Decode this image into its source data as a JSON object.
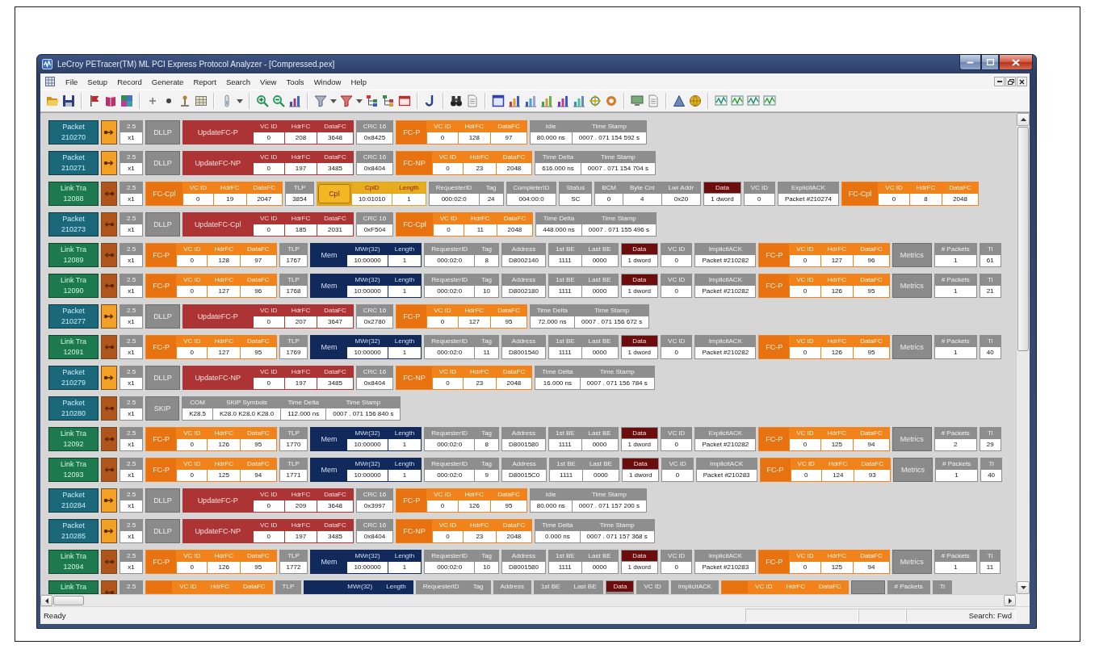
{
  "window": {
    "title": "LeCroy PETracer(TM) ML PCI Express Protocol Analyzer - [Compressed.pex]"
  },
  "menu": [
    "File",
    "Setup",
    "Record",
    "Generate",
    "Report",
    "Search",
    "View",
    "Tools",
    "Window",
    "Help"
  ],
  "rows": [
    {
      "kind": "packet",
      "label": "Packet",
      "number": "210270",
      "upstream": false,
      "cells": [
        {
          "kind": "field",
          "columns": [
            {
              "header": "2.5",
              "value": "x1"
            }
          ]
        },
        {
          "kind": "tag",
          "label": "DLLP"
        },
        {
          "kind": "update_fc",
          "label": "UpdateFC-P",
          "columns": [
            {
              "header": "VC ID",
              "value": "0"
            },
            {
              "header": "HdrFC",
              "value": "208"
            },
            {
              "header": "DataFC",
              "value": "3648"
            }
          ]
        },
        {
          "kind": "field",
          "columns": [
            {
              "header": "CRC 16",
              "value": "0x8425"
            }
          ]
        },
        {
          "kind": "fc",
          "label": "FC-P",
          "columns": [
            {
              "header": "VC ID",
              "value": "0"
            },
            {
              "header": "HdrFC",
              "value": "128"
            },
            {
              "header": "DataFC",
              "value": "97"
            }
          ]
        },
        {
          "kind": "field",
          "columns": [
            {
              "header": "Idle",
              "value": "80.000 ns"
            },
            {
              "header": "Time Stamp",
              "value": "0007 . 071 154 592 s"
            }
          ]
        }
      ]
    },
    {
      "kind": "packet",
      "label": "Packet",
      "number": "210271",
      "upstream": false,
      "cells": [
        {
          "kind": "field",
          "columns": [
            {
              "header": "2.5",
              "value": "x1"
            }
          ]
        },
        {
          "kind": "tag",
          "label": "DLLP"
        },
        {
          "kind": "update_fc",
          "label": "UpdateFC-NP",
          "columns": [
            {
              "header": "VC ID",
              "value": "0"
            },
            {
              "header": "HdrFC",
              "value": "197"
            },
            {
              "header": "DataFC",
              "value": "3485"
            }
          ]
        },
        {
          "kind": "field",
          "columns": [
            {
              "header": "CRC 16",
              "value": "0x8404"
            }
          ]
        },
        {
          "kind": "fc",
          "label": "FC-NP",
          "columns": [
            {
              "header": "VC ID",
              "value": "0"
            },
            {
              "header": "HdrFC",
              "value": "23"
            },
            {
              "header": "DataFC",
              "value": "2048"
            }
          ]
        },
        {
          "kind": "field",
          "columns": [
            {
              "header": "Time Delta",
              "value": "616.000 ns"
            },
            {
              "header": "Time Stamp",
              "value": "0007 . 071 154 704 s"
            }
          ]
        }
      ]
    },
    {
      "kind": "link",
      "label": "Link Tra",
      "number": "12088",
      "upstream": true,
      "cells": [
        {
          "kind": "field",
          "columns": [
            {
              "header": "2.5",
              "value": "x1"
            }
          ]
        },
        {
          "kind": "fc",
          "label": "FC-Cpl",
          "columns": [
            {
              "header": "VC ID",
              "value": "0"
            },
            {
              "header": "HdrFC",
              "value": "19"
            },
            {
              "header": "DataFC",
              "value": "2047"
            }
          ]
        },
        {
          "kind": "field",
          "columns": [
            {
              "header": "TLP",
              "value": "3854"
            }
          ]
        },
        {
          "kind": "cpl",
          "label": "Cpl",
          "columns": [
            {
              "header": "CplD",
              "value": "10:01010"
            },
            {
              "header": "Length",
              "value": "1"
            }
          ]
        },
        {
          "kind": "field",
          "columns": [
            {
              "header": "RequesterID",
              "value": "000:02:0"
            },
            {
              "header": "Tag",
              "value": "24"
            }
          ]
        },
        {
          "kind": "field",
          "columns": [
            {
              "header": "CompleterID",
              "value": "004:00:0"
            }
          ]
        },
        {
          "kind": "field",
          "columns": [
            {
              "header": "Status",
              "value": "SC"
            }
          ]
        },
        {
          "kind": "field",
          "columns": [
            {
              "header": "BCM",
              "value": "0"
            },
            {
              "header": "Byte Cnt",
              "value": "4"
            },
            {
              "header": "Lwr Addr",
              "value": "0x20"
            }
          ]
        },
        {
          "kind": "data",
          "columns": [
            {
              "header": "Data",
              "value": "1 dword"
            }
          ]
        },
        {
          "kind": "field",
          "columns": [
            {
              "header": "VC ID",
              "value": "0"
            }
          ]
        },
        {
          "kind": "field",
          "columns": [
            {
              "header": "ExplicitACK",
              "value": "Packet #210274"
            }
          ]
        },
        {
          "kind": "fc",
          "label": "FC-Cpl",
          "columns": [
            {
              "header": "VC ID",
              "value": "0"
            },
            {
              "header": "HdrFC",
              "value": "8"
            },
            {
              "header": "DataFC",
              "value": "2048"
            }
          ]
        }
      ]
    },
    {
      "kind": "packet",
      "label": "Packet",
      "number": "210273",
      "upstream": true,
      "cells": [
        {
          "kind": "field",
          "columns": [
            {
              "header": "2.5",
              "value": "x1"
            }
          ]
        },
        {
          "kind": "tag",
          "label": "DLLP"
        },
        {
          "kind": "update_fc",
          "label": "UpdateFC-Cpl",
          "columns": [
            {
              "header": "VC ID",
              "value": "0"
            },
            {
              "header": "HdrFC",
              "value": "185"
            },
            {
              "header": "DataFC",
              "value": "2031"
            }
          ]
        },
        {
          "kind": "field",
          "columns": [
            {
              "header": "CRC 16",
              "value": "0xF504"
            }
          ]
        },
        {
          "kind": "fc",
          "label": "FC-Cpl",
          "columns": [
            {
              "header": "VC ID",
              "value": "0"
            },
            {
              "header": "HdrFC",
              "value": "11"
            },
            {
              "header": "DataFC",
              "value": "2048"
            }
          ]
        },
        {
          "kind": "field",
          "columns": [
            {
              "header": "Time Delta",
              "value": "448.000 ns"
            },
            {
              "header": "Time Stamp",
              "value": "0007 . 071 155 496 s"
            }
          ]
        }
      ]
    },
    {
      "kind": "link",
      "label": "Link Tra",
      "number": "12089",
      "upstream": true,
      "cells": [
        {
          "kind": "field",
          "columns": [
            {
              "header": "2.5",
              "value": "x1"
            }
          ]
        },
        {
          "kind": "fc",
          "label": "FC-P",
          "columns": [
            {
              "header": "VC ID",
              "value": "0"
            },
            {
              "header": "HdrFC",
              "value": "128"
            },
            {
              "header": "DataFC",
              "value": "97"
            }
          ]
        },
        {
          "kind": "field",
          "columns": [
            {
              "header": "TLP",
              "value": "1767"
            }
          ]
        },
        {
          "kind": "mem",
          "label": "Mem",
          "columns": [
            {
              "header": "MWr(32)",
              "value": "10:00000"
            },
            {
              "header": "Length",
              "value": "1"
            }
          ]
        },
        {
          "kind": "field",
          "columns": [
            {
              "header": "RequesterID",
              "value": "000:02:0"
            },
            {
              "header": "Tag",
              "value": "8"
            }
          ]
        },
        {
          "kind": "field",
          "columns": [
            {
              "header": "Address",
              "value": "D8002140"
            }
          ]
        },
        {
          "kind": "field",
          "columns": [
            {
              "header": "1st BE",
              "value": "1111"
            },
            {
              "header": "Last BE",
              "value": "0000"
            }
          ]
        },
        {
          "kind": "data",
          "columns": [
            {
              "header": "Data",
              "value": "1 dword"
            }
          ]
        },
        {
          "kind": "field",
          "columns": [
            {
              "header": "VC ID",
              "value": "0"
            }
          ]
        },
        {
          "kind": "field",
          "columns": [
            {
              "header": "ImplicitACK",
              "value": "Packet #210282"
            }
          ]
        },
        {
          "kind": "fc",
          "label": "FC-P",
          "columns": [
            {
              "header": "VC ID",
              "value": "0"
            },
            {
              "header": "HdrFC",
              "value": "127"
            },
            {
              "header": "DataFC",
              "value": "96"
            }
          ]
        },
        {
          "kind": "tag",
          "label": "Metrics"
        },
        {
          "kind": "field",
          "columns": [
            {
              "header": "# Packets",
              "value": "1"
            }
          ]
        },
        {
          "kind": "field",
          "columns": [
            {
              "header": "Ti",
              "value": "61"
            }
          ]
        }
      ]
    },
    {
      "kind": "link",
      "label": "Link Tra",
      "number": "12090",
      "upstream": true,
      "cells": [
        {
          "kind": "field",
          "columns": [
            {
              "header": "2.5",
              "value": "x1"
            }
          ]
        },
        {
          "kind": "fc",
          "label": "FC-P",
          "columns": [
            {
              "header": "VC ID",
              "value": "0"
            },
            {
              "header": "HdrFC",
              "value": "127"
            },
            {
              "header": "DataFC",
              "value": "96"
            }
          ]
        },
        {
          "kind": "field",
          "columns": [
            {
              "header": "TLP",
              "value": "1768"
            }
          ]
        },
        {
          "kind": "mem",
          "label": "Mem",
          "columns": [
            {
              "header": "MWr(32)",
              "value": "10:00000"
            },
            {
              "header": "Length",
              "value": "1"
            }
          ]
        },
        {
          "kind": "field",
          "columns": [
            {
              "header": "RequesterID",
              "value": "000:02:0"
            },
            {
              "header": "Tag",
              "value": "10"
            }
          ]
        },
        {
          "kind": "field",
          "columns": [
            {
              "header": "Address",
              "value": "D8002180"
            }
          ]
        },
        {
          "kind": "field",
          "columns": [
            {
              "header": "1st BE",
              "value": "1111"
            },
            {
              "header": "Last BE",
              "value": "0000"
            }
          ]
        },
        {
          "kind": "data",
          "columns": [
            {
              "header": "Data",
              "value": "1 dword"
            }
          ]
        },
        {
          "kind": "field",
          "columns": [
            {
              "header": "VC ID",
              "value": "0"
            }
          ]
        },
        {
          "kind": "field",
          "columns": [
            {
              "header": "ImplicitACK",
              "value": "Packet #210282"
            }
          ]
        },
        {
          "kind": "fc",
          "label": "FC-P",
          "columns": [
            {
              "header": "VC ID",
              "value": "0"
            },
            {
              "header": "HdrFC",
              "value": "126"
            },
            {
              "header": "DataFC",
              "value": "95"
            }
          ]
        },
        {
          "kind": "tag",
          "label": "Metrics"
        },
        {
          "kind": "field",
          "columns": [
            {
              "header": "# Packets",
              "value": "1"
            }
          ]
        },
        {
          "kind": "field",
          "columns": [
            {
              "header": "Ti",
              "value": "21"
            }
          ]
        }
      ]
    },
    {
      "kind": "packet",
      "label": "Packet",
      "number": "210277",
      "upstream": false,
      "cells": [
        {
          "kind": "field",
          "columns": [
            {
              "header": "2.5",
              "value": "x1"
            }
          ]
        },
        {
          "kind": "tag",
          "label": "DLLP"
        },
        {
          "kind": "update_fc",
          "label": "UpdateFC-P",
          "columns": [
            {
              "header": "VC ID",
              "value": "0"
            },
            {
              "header": "HdrFC",
              "value": "207"
            },
            {
              "header": "DataFC",
              "value": "3647"
            }
          ]
        },
        {
          "kind": "field",
          "columns": [
            {
              "header": "CRC 16",
              "value": "0x2780"
            }
          ]
        },
        {
          "kind": "fc",
          "label": "FC-P",
          "columns": [
            {
              "header": "VC ID",
              "value": "0"
            },
            {
              "header": "HdrFC",
              "value": "127"
            },
            {
              "header": "DataFC",
              "value": "95"
            }
          ]
        },
        {
          "kind": "field",
          "columns": [
            {
              "header": "Time Delta",
              "value": "72.000 ns"
            },
            {
              "header": "Time Stamp",
              "value": "0007 . 071 156 672 s"
            }
          ]
        }
      ]
    },
    {
      "kind": "link",
      "label": "Link Tra",
      "number": "12091",
      "upstream": true,
      "cells": [
        {
          "kind": "field",
          "columns": [
            {
              "header": "2.5",
              "value": "x1"
            }
          ]
        },
        {
          "kind": "fc",
          "label": "FC-P",
          "columns": [
            {
              "header": "VC ID",
              "value": "0"
            },
            {
              "header": "HdrFC",
              "value": "127"
            },
            {
              "header": "DataFC",
              "value": "95"
            }
          ]
        },
        {
          "kind": "field",
          "columns": [
            {
              "header": "TLP",
              "value": "1769"
            }
          ]
        },
        {
          "kind": "mem",
          "label": "Mem",
          "columns": [
            {
              "header": "MWr(32)",
              "value": "10:00000"
            },
            {
              "header": "Length",
              "value": "1"
            }
          ]
        },
        {
          "kind": "field",
          "columns": [
            {
              "header": "RequesterID",
              "value": "000:02:0"
            },
            {
              "header": "Tag",
              "value": "11"
            }
          ]
        },
        {
          "kind": "field",
          "columns": [
            {
              "header": "Address",
              "value": "D8001540"
            }
          ]
        },
        {
          "kind": "field",
          "columns": [
            {
              "header": "1st BE",
              "value": "1111"
            },
            {
              "header": "Last BE",
              "value": "0000"
            }
          ]
        },
        {
          "kind": "data",
          "columns": [
            {
              "header": "Data",
              "value": "1 dword"
            }
          ]
        },
        {
          "kind": "field",
          "columns": [
            {
              "header": "VC ID",
              "value": "0"
            }
          ]
        },
        {
          "kind": "field",
          "columns": [
            {
              "header": "ImplicitACK",
              "value": "Packet #210282"
            }
          ]
        },
        {
          "kind": "fc",
          "label": "FC-P",
          "columns": [
            {
              "header": "VC ID",
              "value": "0"
            },
            {
              "header": "HdrFC",
              "value": "126"
            },
            {
              "header": "DataFC",
              "value": "95"
            }
          ]
        },
        {
          "kind": "tag",
          "label": "Metrics"
        },
        {
          "kind": "field",
          "columns": [
            {
              "header": "# Packets",
              "value": "1"
            }
          ]
        },
        {
          "kind": "field",
          "columns": [
            {
              "header": "Ti",
              "value": "40"
            }
          ]
        }
      ]
    },
    {
      "kind": "packet",
      "label": "Packet",
      "number": "210279",
      "upstream": false,
      "cells": [
        {
          "kind": "field",
          "columns": [
            {
              "header": "2.5",
              "value": "x1"
            }
          ]
        },
        {
          "kind": "tag",
          "label": "DLLP"
        },
        {
          "kind": "update_fc",
          "label": "UpdateFC-NP",
          "columns": [
            {
              "header": "VC ID",
              "value": "0"
            },
            {
              "header": "HdrFC",
              "value": "197"
            },
            {
              "header": "DataFC",
              "value": "3485"
            }
          ]
        },
        {
          "kind": "field",
          "columns": [
            {
              "header": "CRC 16",
              "value": "0x8404"
            }
          ]
        },
        {
          "kind": "fc",
          "label": "FC-NP",
          "columns": [
            {
              "header": "VC ID",
              "value": "0"
            },
            {
              "header": "HdrFC",
              "value": "23"
            },
            {
              "header": "DataFC",
              "value": "2048"
            }
          ]
        },
        {
          "kind": "field",
          "columns": [
            {
              "header": "Time Delta",
              "value": "16.000 ns"
            },
            {
              "header": "Time Stamp",
              "value": "0007 . 071 156 784 s"
            }
          ]
        }
      ]
    },
    {
      "kind": "packet",
      "label": "Packet",
      "number": "210280",
      "upstream": true,
      "cells": [
        {
          "kind": "field",
          "columns": [
            {
              "header": "2.5",
              "value": "x1"
            }
          ]
        },
        {
          "kind": "tag",
          "label": "SKIP"
        },
        {
          "kind": "field",
          "columns": [
            {
              "header": "COM",
              "value": "K28.5"
            },
            {
              "header": "SKIP Symbols",
              "value": "K28.0 K28.0 K28.0"
            },
            {
              "header": "Time Delta",
              "value": "112.000 ns"
            },
            {
              "header": "Time Stamp",
              "value": "0007 . 071 156 840 s"
            }
          ]
        }
      ]
    },
    {
      "kind": "link",
      "label": "Link Tra",
      "number": "12092",
      "upstream": true,
      "cells": [
        {
          "kind": "field",
          "columns": [
            {
              "header": "2.5",
              "value": "x1"
            }
          ]
        },
        {
          "kind": "fc",
          "label": "FC-P",
          "columns": [
            {
              "header": "VC ID",
              "value": "0"
            },
            {
              "header": "HdrFC",
              "value": "126"
            },
            {
              "header": "DataFC",
              "value": "95"
            }
          ]
        },
        {
          "kind": "field",
          "columns": [
            {
              "header": "TLP",
              "value": "1770"
            }
          ]
        },
        {
          "kind": "mem",
          "label": "Mem",
          "columns": [
            {
              "header": "MWr(32)",
              "value": "10:00000"
            },
            {
              "header": "Length",
              "value": "1"
            }
          ]
        },
        {
          "kind": "field",
          "columns": [
            {
              "header": "RequesterID",
              "value": "000:02:0"
            },
            {
              "header": "Tag",
              "value": "8"
            }
          ]
        },
        {
          "kind": "field",
          "columns": [
            {
              "header": "Address",
              "value": "D8001580"
            }
          ]
        },
        {
          "kind": "field",
          "columns": [
            {
              "header": "1st BE",
              "value": "1111"
            },
            {
              "header": "Last BE",
              "value": "0000"
            }
          ]
        },
        {
          "kind": "data",
          "columns": [
            {
              "header": "Data",
              "value": "1 dword"
            }
          ]
        },
        {
          "kind": "field",
          "columns": [
            {
              "header": "VC ID",
              "value": "0"
            }
          ]
        },
        {
          "kind": "field",
          "columns": [
            {
              "header": "ExplicitACK",
              "value": "Packet #210282"
            }
          ]
        },
        {
          "kind": "fc",
          "label": "FC-P",
          "columns": [
            {
              "header": "VC ID",
              "value": "0"
            },
            {
              "header": "HdrFC",
              "value": "125"
            },
            {
              "header": "DataFC",
              "value": "94"
            }
          ]
        },
        {
          "kind": "tag",
          "label": "Metrics"
        },
        {
          "kind": "field",
          "columns": [
            {
              "header": "# Packets",
              "value": "2"
            }
          ]
        },
        {
          "kind": "field",
          "columns": [
            {
              "header": "Ti",
              "value": "29"
            }
          ]
        }
      ]
    },
    {
      "kind": "link",
      "label": "Link Tra",
      "number": "12093",
      "upstream": true,
      "cells": [
        {
          "kind": "field",
          "columns": [
            {
              "header": "2.5",
              "value": "x1"
            }
          ]
        },
        {
          "kind": "fc",
          "label": "FC-P",
          "columns": [
            {
              "header": "VC ID",
              "value": "0"
            },
            {
              "header": "HdrFC",
              "value": "125"
            },
            {
              "header": "DataFC",
              "value": "94"
            }
          ]
        },
        {
          "kind": "field",
          "columns": [
            {
              "header": "TLP",
              "value": "1771"
            }
          ]
        },
        {
          "kind": "mem",
          "label": "Mem",
          "columns": [
            {
              "header": "MWr(32)",
              "value": "10:00000"
            },
            {
              "header": "Length",
              "value": "1"
            }
          ]
        },
        {
          "kind": "field",
          "columns": [
            {
              "header": "RequesterID",
              "value": "000:02:0"
            },
            {
              "header": "Tag",
              "value": "9"
            }
          ]
        },
        {
          "kind": "field",
          "columns": [
            {
              "header": "Address",
              "value": "D80015C0"
            }
          ]
        },
        {
          "kind": "field",
          "columns": [
            {
              "header": "1st BE",
              "value": "1111"
            },
            {
              "header": "Last BE",
              "value": "0000"
            }
          ]
        },
        {
          "kind": "data",
          "columns": [
            {
              "header": "Data",
              "value": "1 dword"
            }
          ]
        },
        {
          "kind": "field",
          "columns": [
            {
              "header": "VC ID",
              "value": "0"
            }
          ]
        },
        {
          "kind": "field",
          "columns": [
            {
              "header": "ImplicitACK",
              "value": "Packet #210283"
            }
          ]
        },
        {
          "kind": "fc",
          "label": "FC-P",
          "columns": [
            {
              "header": "VC ID",
              "value": "0"
            },
            {
              "header": "HdrFC",
              "value": "124"
            },
            {
              "header": "DataFC",
              "value": "93"
            }
          ]
        },
        {
          "kind": "tag",
          "label": "Metrics"
        },
        {
          "kind": "field",
          "columns": [
            {
              "header": "# Packets",
              "value": "1"
            }
          ]
        },
        {
          "kind": "field",
          "columns": [
            {
              "header": "Ti",
              "value": "40"
            }
          ]
        }
      ]
    },
    {
      "kind": "packet",
      "label": "Packet",
      "number": "210284",
      "upstream": false,
      "cells": [
        {
          "kind": "field",
          "columns": [
            {
              "header": "2.5",
              "value": "x1"
            }
          ]
        },
        {
          "kind": "tag",
          "label": "DLLP"
        },
        {
          "kind": "update_fc",
          "label": "UpdateFC-P",
          "columns": [
            {
              "header": "VC ID",
              "value": "0"
            },
            {
              "header": "HdrFC",
              "value": "209"
            },
            {
              "header": "DataFC",
              "value": "3648"
            }
          ]
        },
        {
          "kind": "field",
          "columns": [
            {
              "header": "CRC 16",
              "value": "0x3997"
            }
          ]
        },
        {
          "kind": "fc",
          "label": "FC-P",
          "columns": [
            {
              "header": "VC ID",
              "value": "0"
            },
            {
              "header": "HdrFC",
              "value": "126"
            },
            {
              "header": "DataFC",
              "value": "95"
            }
          ]
        },
        {
          "kind": "field",
          "columns": [
            {
              "header": "Idle",
              "value": "80.000 ns"
            },
            {
              "header": "Time Stamp",
              "value": "0007 . 071 157 200 s"
            }
          ]
        }
      ]
    },
    {
      "kind": "packet",
      "label": "Packet",
      "number": "210285",
      "upstream": false,
      "cells": [
        {
          "kind": "field",
          "columns": [
            {
              "header": "2.5",
              "value": "x1"
            }
          ]
        },
        {
          "kind": "tag",
          "label": "DLLP"
        },
        {
          "kind": "update_fc",
          "label": "UpdateFC-NP",
          "columns": [
            {
              "header": "VC ID",
              "value": "0"
            },
            {
              "header": "HdrFC",
              "value": "197"
            },
            {
              "header": "DataFC",
              "value": "3485"
            }
          ]
        },
        {
          "kind": "field",
          "columns": [
            {
              "header": "CRC 16",
              "value": "0x8404"
            }
          ]
        },
        {
          "kind": "fc",
          "label": "FC-NP",
          "columns": [
            {
              "header": "VC ID",
              "value": "0"
            },
            {
              "header": "HdrFC",
              "value": "23"
            },
            {
              "header": "DataFC",
              "value": "2048"
            }
          ]
        },
        {
          "kind": "field",
          "columns": [
            {
              "header": "Time Delta",
              "value": "0.000 ns"
            },
            {
              "header": "Time Stamp",
              "value": "0007 . 071 157 368 s"
            }
          ]
        }
      ]
    },
    {
      "kind": "link",
      "label": "Link Tra",
      "number": "12094",
      "upstream": true,
      "cells": [
        {
          "kind": "field",
          "columns": [
            {
              "header": "2.5",
              "value": "x1"
            }
          ]
        },
        {
          "kind": "fc",
          "label": "FC-P",
          "columns": [
            {
              "header": "VC ID",
              "value": "0"
            },
            {
              "header": "HdrFC",
              "value": "126"
            },
            {
              "header": "DataFC",
              "value": "95"
            }
          ]
        },
        {
          "kind": "field",
          "columns": [
            {
              "header": "TLP",
              "value": "1772"
            }
          ]
        },
        {
          "kind": "mem",
          "label": "Mem",
          "columns": [
            {
              "header": "MWr(32)",
              "value": "10:00000"
            },
            {
              "header": "Length",
              "value": "1"
            }
          ]
        },
        {
          "kind": "field",
          "columns": [
            {
              "header": "RequesterID",
              "value": "000:02:0"
            },
            {
              "header": "Tag",
              "value": "10"
            }
          ]
        },
        {
          "kind": "field",
          "columns": [
            {
              "header": "Address",
              "value": "D8001580"
            }
          ]
        },
        {
          "kind": "field",
          "columns": [
            {
              "header": "1st BE",
              "value": "1111"
            },
            {
              "header": "Last BE",
              "value": "0000"
            }
          ]
        },
        {
          "kind": "data",
          "columns": [
            {
              "header": "Data",
              "value": "1 dword"
            }
          ]
        },
        {
          "kind": "field",
          "columns": [
            {
              "header": "VC ID",
              "value": "0"
            }
          ]
        },
        {
          "kind": "field",
          "columns": [
            {
              "header": "ImplicitACK",
              "value": "Packet #210283"
            }
          ]
        },
        {
          "kind": "fc",
          "label": "FC-P",
          "columns": [
            {
              "header": "VC ID",
              "value": "0"
            },
            {
              "header": "HdrFC",
              "value": "125"
            },
            {
              "header": "DataFC",
              "value": "94"
            }
          ]
        },
        {
          "kind": "tag",
          "label": "Metrics"
        },
        {
          "kind": "field",
          "columns": [
            {
              "header": "# Packets",
              "value": "1"
            }
          ]
        },
        {
          "kind": "field",
          "columns": [
            {
              "header": "Ti",
              "value": "11"
            }
          ]
        }
      ]
    },
    {
      "kind": "link",
      "label": "Link Tra",
      "upstream": true,
      "cells": [
        {
          "kind": "field",
          "columns": [
            {
              "header": "2.5"
            }
          ]
        },
        {
          "kind": "fc",
          "columns": [
            {
              "header": "VC ID"
            },
            {
              "header": "HdrFC"
            },
            {
              "header": "DataFC"
            }
          ]
        },
        {
          "kind": "field",
          "columns": [
            {
              "header": "TLP"
            }
          ]
        },
        {
          "kind": "mem",
          "columns": [
            {
              "header": "MWr(32)"
            },
            {
              "header": "Length"
            }
          ]
        },
        {
          "kind": "field",
          "columns": [
            {
              "header": "RequesterID"
            },
            {
              "header": "Tag"
            }
          ]
        },
        {
          "kind": "field",
          "columns": [
            {
              "header": "Address"
            }
          ]
        },
        {
          "kind": "field",
          "columns": [
            {
              "header": "1st BE"
            },
            {
              "header": "Last BE"
            }
          ]
        },
        {
          "kind": "data",
          "columns": [
            {
              "header": "Data"
            }
          ]
        },
        {
          "kind": "field",
          "columns": [
            {
              "header": "VC ID"
            }
          ]
        },
        {
          "kind": "field",
          "columns": [
            {
              "header": "ImplicitACK"
            }
          ]
        },
        {
          "kind": "fc",
          "columns": [
            {
              "header": "VC ID"
            },
            {
              "header": "HdrFC"
            },
            {
              "header": "DataFC"
            }
          ]
        },
        {
          "kind": "tag"
        },
        {
          "kind": "field",
          "columns": [
            {
              "header": "# Packets"
            }
          ]
        },
        {
          "kind": "field",
          "columns": [
            {
              "header": "Ti"
            }
          ]
        }
      ]
    }
  ],
  "status_bar": {
    "message": "Ready",
    "search": "Search: Fwd"
  }
}
